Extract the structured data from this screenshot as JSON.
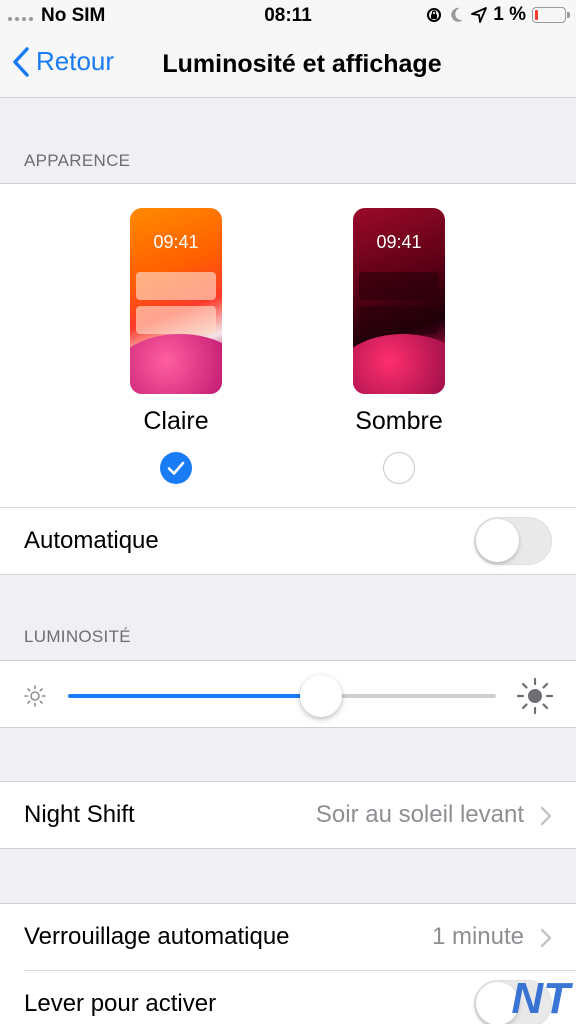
{
  "status_bar": {
    "carrier": "No SIM",
    "time": "08:11",
    "battery": "1 %",
    "battery_level": 0.01
  },
  "nav": {
    "back_label": "Retour",
    "title": "Luminosité et affichage"
  },
  "appearance": {
    "header": "APPARENCE",
    "light": {
      "label": "Claire",
      "preview_time": "09:41",
      "selected": true
    },
    "dark": {
      "label": "Sombre",
      "preview_time": "09:41",
      "selected": false
    },
    "automatic_label": "Automatique",
    "automatic_on": false
  },
  "brightness": {
    "header": "LUMINOSITÉ",
    "level": 0.59
  },
  "night_shift": {
    "label": "Night Shift",
    "value": "Soir au soleil levant"
  },
  "auto_lock": {
    "label": "Verrouillage automatique",
    "value": "1 minute"
  },
  "raise_to_wake": {
    "label": "Lever pour activer",
    "on": false
  },
  "watermark": "NT",
  "colors": {
    "accent": "#1a7cf5",
    "secondary_text": "#8e8e93",
    "background": "#efeff4"
  }
}
